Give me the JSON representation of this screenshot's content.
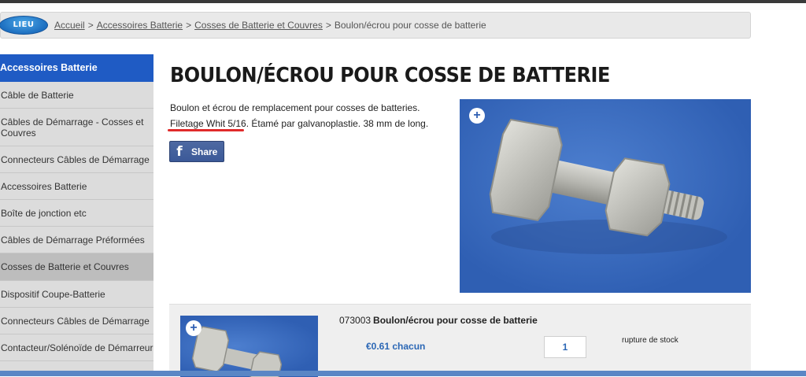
{
  "breadcrumb": {
    "logo_text": "LIEU",
    "items": [
      "Accueil",
      "Accessoires Batterie",
      "Cosses de Batterie et Couvres"
    ],
    "current": "Boulon/écrou pour cosse de batterie",
    "separator": ">"
  },
  "sidebar": {
    "header": "Accessoires Batterie",
    "items": [
      {
        "label": "Câble de Batterie"
      },
      {
        "label": "Câbles de Démarrage - Cosses et Couvres"
      },
      {
        "label": "Connecteurs Câbles de Démarrage"
      },
      {
        "label": "Accessoires Batterie"
      },
      {
        "label": "Boîte de jonction etc"
      },
      {
        "label": "Câbles de Démarrage Préformées"
      },
      {
        "label": "Cosses de Batterie et Couvres"
      },
      {
        "label": "Dispositif Coupe-Batterie"
      },
      {
        "label": "Connecteurs Câbles de Démarrage"
      },
      {
        "label": "Contacteur/Solénoïde de Démarreur"
      }
    ],
    "active_index": 6
  },
  "product": {
    "title": "BOULON/ÉCROU POUR COSSE DE BATTERIE",
    "description_line1": "Boulon et écrou de remplacement pour cosses de batteries.",
    "description_highlight": "Filetage Whit 5/16",
    "description_rest": ". Étamé par galvanoplastie. 38 mm de long.",
    "share_label": "Share",
    "share_icon": "f",
    "zoom_icon": "+"
  },
  "variant": {
    "sku": "073003",
    "name": "Boulon/écrou pour cosse de batterie",
    "price": "€0.61 chacun",
    "quantity": "1",
    "stock_status": "rupture de stock"
  },
  "colors": {
    "accent_blue": "#1f5bc4",
    "highlight_red": "#e02b2b",
    "price_blue": "#2b67b5",
    "facebook": "#3b5998"
  }
}
